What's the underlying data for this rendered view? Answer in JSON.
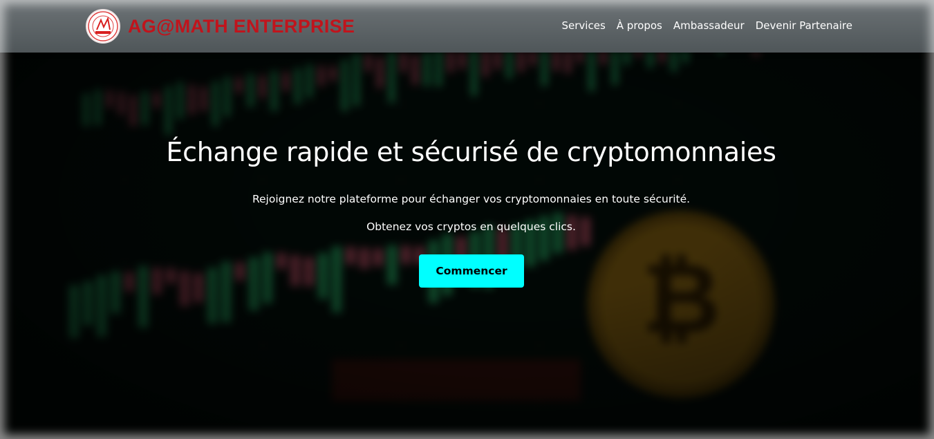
{
  "header": {
    "brand_name": "AG@MATH ENTERPRISE",
    "nav": [
      {
        "label": "Services"
      },
      {
        "label": "À propos"
      },
      {
        "label": "Ambassadeur"
      },
      {
        "label": "Devenir Partenaire"
      }
    ]
  },
  "hero": {
    "title": "Échange rapide et sécurisé de cryptomonnaies",
    "subtitle_1": "Rejoignez notre plateforme pour échanger vos cryptomonnaies en toute sécurité.",
    "subtitle_2": "Obtenez vos cryptos en quelques clics.",
    "cta_label": "Commencer"
  },
  "colors": {
    "brand_red": "#c0141c",
    "cta_cyan": "#00ffff",
    "header_bg": "#5a6164",
    "candle_up": "#2fd07a",
    "candle_down": "#e0607a",
    "coin_gold": "#c99a1e"
  },
  "background": {
    "icons": [
      "candlestick-chart-background",
      "bitcoin-coin-icon"
    ]
  }
}
